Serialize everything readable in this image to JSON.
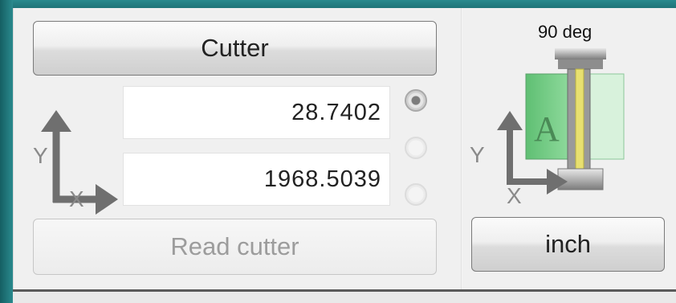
{
  "cutter_panel": {
    "cutter_button_label": "Cutter",
    "y_value": "28.7402",
    "x_value": "1968.5039",
    "read_cutter_label": "Read cutter",
    "axis_y_label": "Y",
    "axis_x_label": "X",
    "radio_options": [
      {
        "name": "position-1",
        "selected": true
      },
      {
        "name": "position-2",
        "selected": false
      },
      {
        "name": "position-3",
        "selected": false
      }
    ]
  },
  "orientation_panel": {
    "angle_label": "90 deg",
    "letter_label": "A",
    "axis_y_label": "Y",
    "axis_x_label": "X",
    "unit_button_label": "inch"
  },
  "colors": {
    "background": "#1d6f73",
    "panel": "#f0f0f0",
    "material_green": "#7cd08a",
    "guide_yellow": "#e8e070",
    "arrow_gray": "#6f6f6f"
  }
}
